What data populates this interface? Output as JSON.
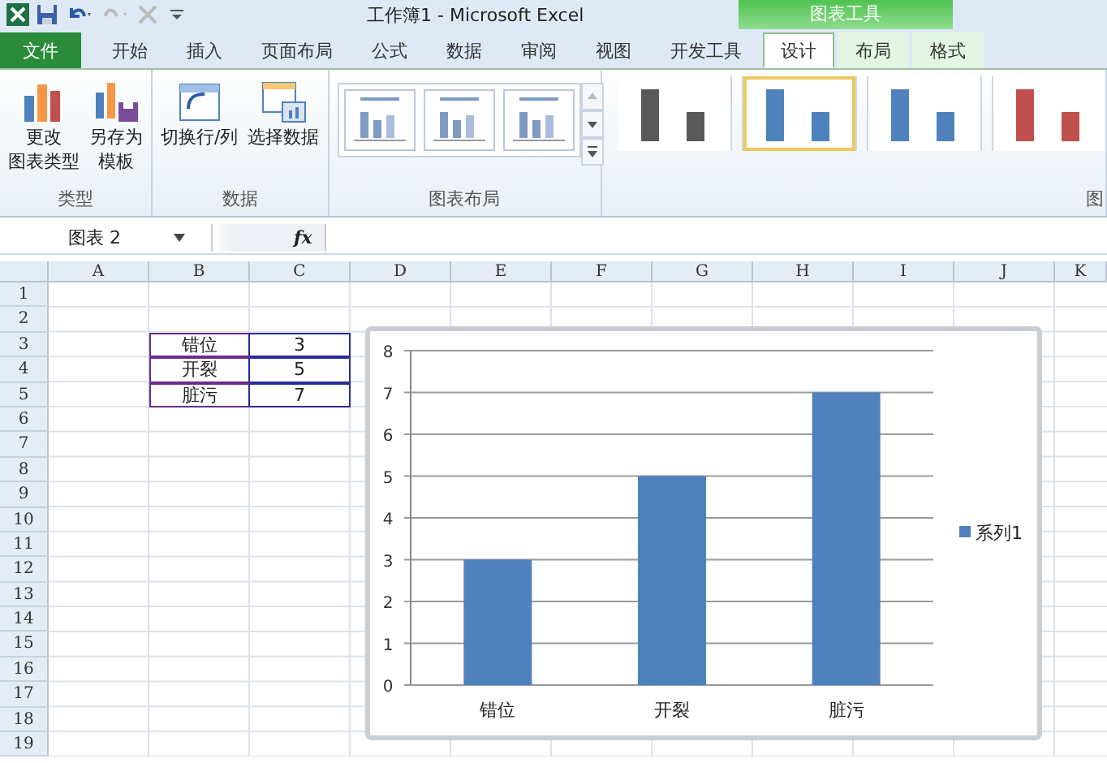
{
  "window": {
    "title": "工作簿1 - Microsoft Excel"
  },
  "context_group": {
    "label": "图表工具"
  },
  "tabs": [
    {
      "label": "文件",
      "kind": "file",
      "selected": false
    },
    {
      "label": "开始",
      "kind": "tab",
      "selected": false
    },
    {
      "label": "插入",
      "kind": "tab",
      "selected": false
    },
    {
      "label": "页面布局",
      "kind": "tab",
      "selected": false
    },
    {
      "label": "公式",
      "kind": "tab",
      "selected": false
    },
    {
      "label": "数据",
      "kind": "tab",
      "selected": false
    },
    {
      "label": "审阅",
      "kind": "tab",
      "selected": false
    },
    {
      "label": "视图",
      "kind": "tab",
      "selected": false
    },
    {
      "label": "开发工具",
      "kind": "tab",
      "selected": false
    },
    {
      "label": "设计",
      "kind": "context",
      "selected": true
    },
    {
      "label": "布局",
      "kind": "context",
      "selected": false
    },
    {
      "label": "格式",
      "kind": "context",
      "selected": false
    }
  ],
  "ribbon": {
    "groups": [
      {
        "label": "类型",
        "kind": "buttons",
        "buttons": [
          {
            "lines": [
              "更改",
              "图表类型"
            ]
          },
          {
            "lines": [
              "另存为",
              "模板"
            ]
          }
        ]
      },
      {
        "label": "数据",
        "kind": "buttons",
        "buttons": [
          {
            "lines": [
              "切换行/列"
            ]
          },
          {
            "lines": [
              "选择数据"
            ]
          }
        ]
      },
      {
        "label": "图表布局",
        "kind": "layouts",
        "layouts": [
          {
            "selected": false
          },
          {
            "selected": false
          },
          {
            "selected": false
          }
        ]
      },
      {
        "label": "图",
        "kind": "styles",
        "styles": [
          {
            "color": "#595959",
            "selected": false
          },
          {
            "color": "#4f81bd",
            "selected": true
          },
          {
            "color": "#4f81bd",
            "selected": false
          },
          {
            "color": "#c0504d",
            "selected": false
          }
        ]
      }
    ]
  },
  "formula_bar": {
    "name_box": "图表 2",
    "fx": "fx"
  },
  "sheet": {
    "columns": [
      "A",
      "B",
      "C",
      "D",
      "E",
      "F",
      "G",
      "H",
      "I",
      "J",
      "K"
    ],
    "rows": [
      "1",
      "2",
      "3",
      "4",
      "5",
      "6",
      "7",
      "8",
      "9",
      "10",
      "11",
      "12",
      "13",
      "14",
      "15",
      "16",
      "17",
      "18",
      "19"
    ],
    "data": [
      {
        "label": "错位",
        "value": "3"
      },
      {
        "label": "开裂",
        "value": "5"
      },
      {
        "label": "脏污",
        "value": "7"
      }
    ]
  },
  "chart": {
    "chart_data": {
      "type": "bar",
      "categories": [
        "错位",
        "开裂",
        "脏污"
      ],
      "series": [
        {
          "name": "系列1",
          "color": "#4f81bd",
          "values": [
            3,
            5,
            7
          ]
        }
      ],
      "ylim": [
        0,
        8
      ],
      "grid": true,
      "yticks": [
        0,
        1,
        2,
        3,
        4,
        5,
        6,
        7,
        8
      ]
    }
  }
}
